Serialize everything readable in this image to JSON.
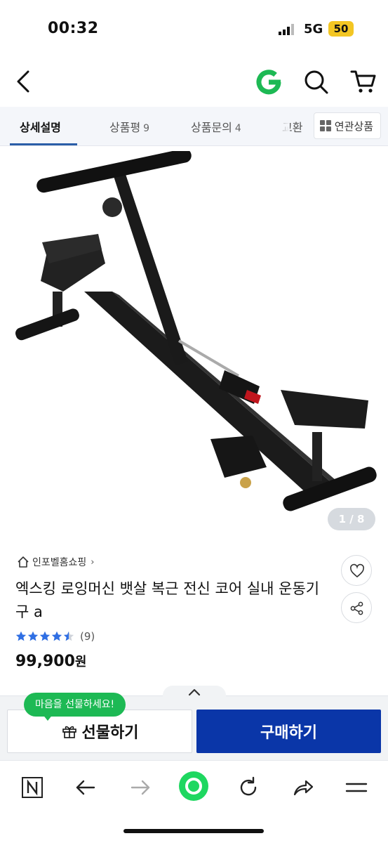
{
  "status_bar": {
    "time": "00:32",
    "network": "5G",
    "battery": "50"
  },
  "tabs": [
    {
      "label": "상세설명",
      "count": ""
    },
    {
      "label": "상품평",
      "count": "9"
    },
    {
      "label": "상품문의",
      "count": "4"
    },
    {
      "label": "교환",
      "count": ""
    }
  ],
  "related_label": "연관상품",
  "image_pager": "1 / 8",
  "product": {
    "store": "인포벨홈쇼핑",
    "title": "엑스킹 로잉머신 뱃살 복근 전신 코어 실내 운동기구 a",
    "rating_value": 4.5,
    "rating_count": "(9)",
    "price": "99,900",
    "currency": "원"
  },
  "gift_bubble": "마음을 선물하세요!",
  "buttons": {
    "gift": "선물하기",
    "buy": "구매하기"
  },
  "colors": {
    "brand_green": "#1db954",
    "buy_blue": "#0a36a8",
    "tab_active": "#2a5ea8",
    "star": "#2f6fe4"
  }
}
